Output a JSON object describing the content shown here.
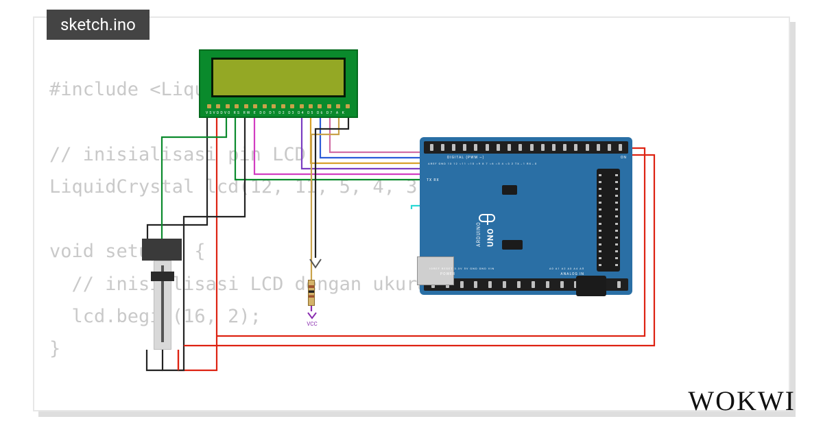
{
  "tab": {
    "title": "sketch.ino"
  },
  "code": {
    "line1": "#include <LiquidCrystal.h>",
    "line2": "",
    "line3": "// inisialisasi pin LCD",
    "line4": "LiquidCrystal lcd(12, 11, 5, 4, 3, 2);",
    "line5": "",
    "line6": "void setup() {",
    "line7": "  // inisialisasi LCD dengan ukuran 16x2",
    "line8": "  lcd.begin(16, 2);",
    "line9": "}"
  },
  "lcd": {
    "pin_labels": "VSVDDV0 RS RW E D0 D1 D2 D3 D4 D5 D6 D7 A  K"
  },
  "arduino": {
    "board_label": "UNO",
    "brand_label": "ARDUINO",
    "digital_label": "DIGITAL (PWM ~)",
    "power_label": "POWER",
    "analog_label": "ANALOG IN",
    "digital_pins": "AREF GND 13 12 ~11 ~10 ~9 8   7 ~6 ~5 4 ~3 2 TX→1 RX←0",
    "power_pins": "IOREF RESET 3.3V 5V GND GND VIN",
    "analog_pins": "A0 A1 A2 A3 A4 A5",
    "txrx": "TX  RX",
    "on": "ON"
  },
  "symbols": {
    "vcc": "VCC"
  },
  "logo": {
    "text": "WOKWI"
  },
  "wiring": {
    "lcd_to_arduino": [
      {
        "lcd_pin": "RS",
        "arduino_pin": "12",
        "color": "green"
      },
      {
        "lcd_pin": "E",
        "arduino_pin": "11",
        "color": "magenta"
      },
      {
        "lcd_pin": "D4",
        "arduino_pin": "5",
        "color": "purple"
      },
      {
        "lcd_pin": "D5",
        "arduino_pin": "4",
        "color": "orange"
      },
      {
        "lcd_pin": "D6",
        "arduino_pin": "3",
        "color": "blue"
      },
      {
        "lcd_pin": "D7",
        "arduino_pin": "2",
        "color": "cyan"
      }
    ],
    "lcd_power": [
      {
        "lcd_pin": "VSS",
        "to": "GND",
        "color": "black"
      },
      {
        "lcd_pin": "VDD",
        "to": "5V",
        "color": "red"
      },
      {
        "lcd_pin": "RW",
        "to": "GND",
        "color": "black"
      },
      {
        "lcd_pin": "K",
        "to": "GND",
        "color": "black"
      },
      {
        "lcd_pin": "A",
        "to": "VCC via resistor",
        "color": "gold"
      }
    ],
    "potentiometer": [
      {
        "pot_pin": "left",
        "to": "GND",
        "color": "black"
      },
      {
        "pot_pin": "wiper",
        "to": "LCD V0",
        "color": "green"
      },
      {
        "pot_pin": "right",
        "to": "5V",
        "color": "red"
      }
    ],
    "arduino_power": [
      {
        "from": "5V",
        "to": "rail",
        "color": "red"
      },
      {
        "from": "GND",
        "to": "rail",
        "color": "red"
      }
    ]
  }
}
